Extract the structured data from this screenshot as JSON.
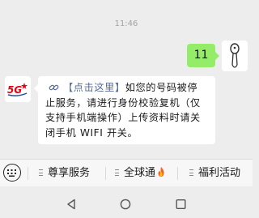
{
  "chat": {
    "timestamp": "11:46",
    "sent_message": "11",
    "received_message": {
      "link_label": "【点击这里】",
      "body": "如您的号码被停止服务，请进行身份校验复机（仅支持手机端操作）上传资料时请关闭手机 WIFI 开关。"
    },
    "sender_logo_text": "5G"
  },
  "menu": {
    "items": [
      {
        "label": "尊享服务"
      },
      {
        "label": "全球通"
      },
      {
        "label": "福利活动"
      }
    ]
  },
  "colors": {
    "sent_bubble": "#95ec69",
    "link": "#576b95",
    "logo_red": "#e60012"
  }
}
